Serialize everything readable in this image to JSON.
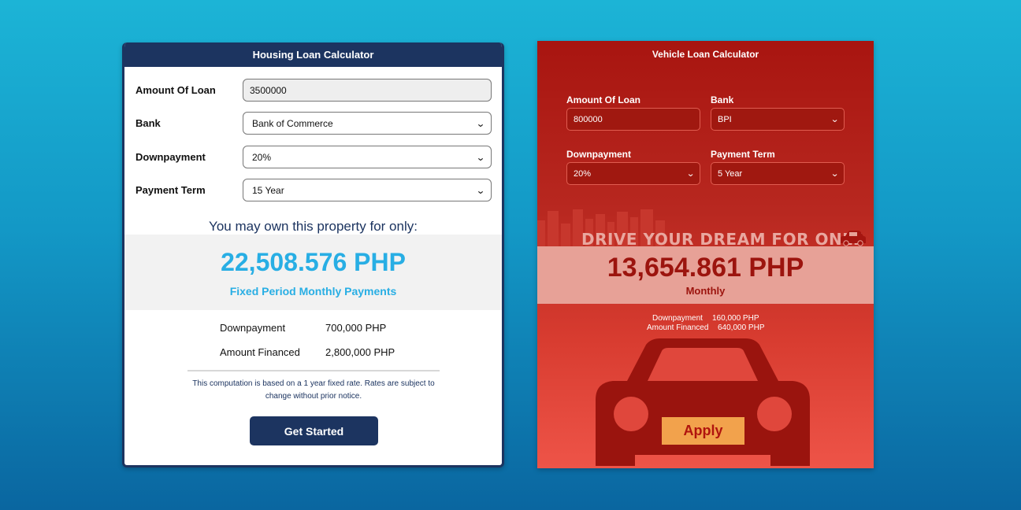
{
  "housing": {
    "title": "Housing Loan Calculator",
    "fields": [
      {
        "label": "Amount Of Loan",
        "value": "3500000"
      },
      {
        "label": "Bank",
        "value": "Bank of Commerce"
      },
      {
        "label": "Downpayment",
        "value": "20%"
      },
      {
        "label": "Payment Term",
        "value": "15 Year"
      }
    ],
    "own_text": "You may own this property for only:",
    "monthly_amount": "22,508.576 PHP",
    "monthly_caption": "Fixed Period Monthly Payments",
    "details": [
      {
        "label": "Downpayment",
        "value": "700,000 PHP"
      },
      {
        "label": "Amount Financed",
        "value": "2,800,000 PHP"
      }
    ],
    "note": "This computation is based on a 1 year fixed rate. Rates are subject to change without prior notice.",
    "button": "Get Started"
  },
  "vehicle": {
    "title": "Vehicle Loan Calculator",
    "fields": [
      {
        "label": "Amount Of Loan",
        "value": "800000"
      },
      {
        "label": "Bank",
        "value": "BPI"
      },
      {
        "label": "Downpayment",
        "value": "20%"
      },
      {
        "label": "Payment Term",
        "value": "5 Year"
      }
    ],
    "tagline": "DRIVE YOUR DREAM FOR ONLY",
    "monthly_amount": "13,654.861 PHP",
    "monthly_caption": "Monthly",
    "details": [
      {
        "label": "Downpayment",
        "value": "160,000 PHP"
      },
      {
        "label": "Amount Financed",
        "value": "640,000 PHP"
      }
    ],
    "button": "Apply"
  },
  "icons": {
    "dropdown": "chevron-down-icon",
    "vehicle_small": "car-icon",
    "vehicle_big": "car-illustration",
    "skyline": "city-skyline-illustration"
  },
  "colors": {
    "navy": "#1c3460",
    "accent_blue": "#28aee4",
    "vehicle_red": "#a81510",
    "apply_orange": "#f2a24c",
    "background_blue": "#1398c6"
  }
}
